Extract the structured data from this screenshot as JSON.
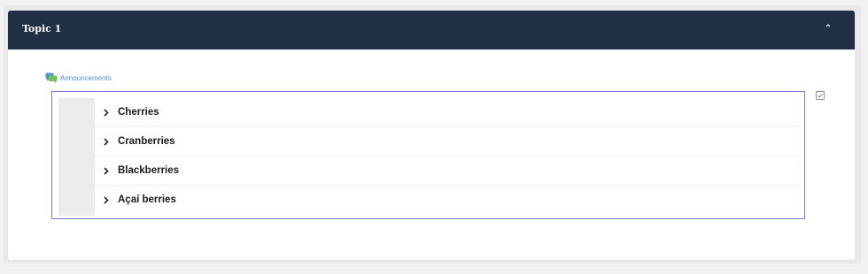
{
  "topic": {
    "title": "Topic 1",
    "collapse_icon": "chevron-up-icon"
  },
  "activity": {
    "icon": "forum-icon",
    "label": "Announcements",
    "completion_icon": "checkbox-checked-icon"
  },
  "accordion": {
    "chevron_icon": "chevron-right-icon",
    "items": [
      {
        "label": "Cherries"
      },
      {
        "label": "Cranberries"
      },
      {
        "label": "Blackberries"
      },
      {
        "label": "Açaí berries"
      }
    ]
  },
  "colors": {
    "header_bg": "#1f2f46",
    "link": "#4a90d9",
    "accordion_border": "#6f78e8"
  }
}
